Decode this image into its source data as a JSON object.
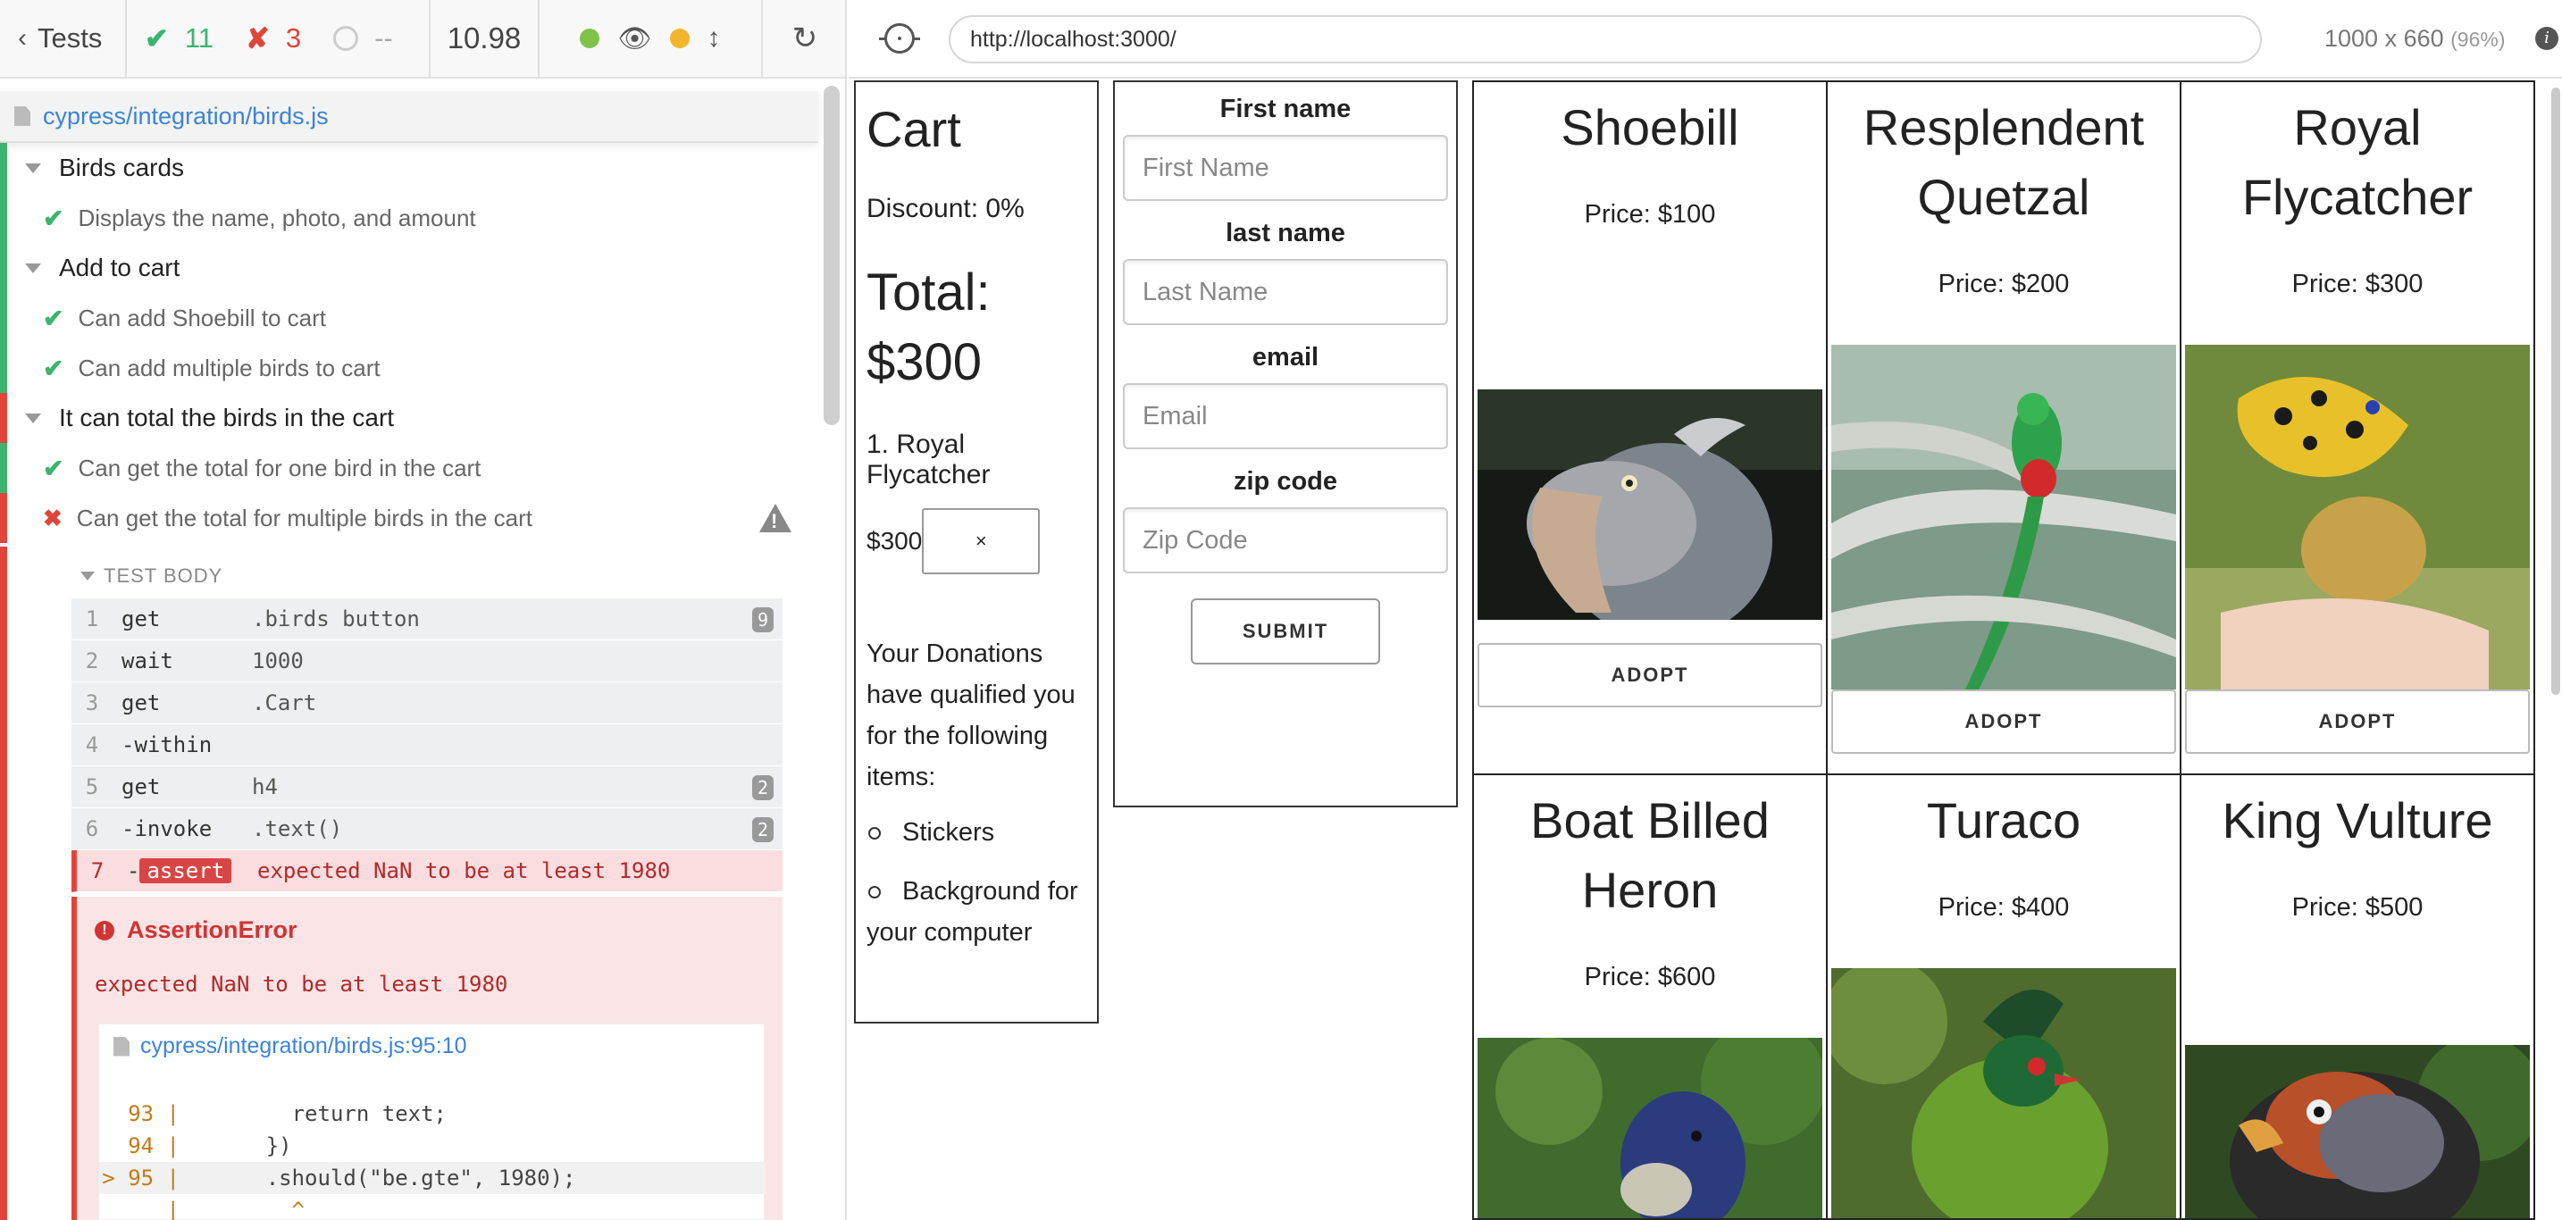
{
  "runner": {
    "back_label": "Tests",
    "passed": "11",
    "failed": "3",
    "pending": "--",
    "duration": "10.98",
    "spec_path": "cypress/integration/birds.js",
    "suites": [
      {
        "title": "Birds cards",
        "tests": [
          {
            "title": "Displays the name, photo, and amount",
            "state": "passed"
          }
        ]
      },
      {
        "title": "Add to cart",
        "tests": [
          {
            "title": "Can add Shoebill to cart",
            "state": "passed"
          },
          {
            "title": "Can add multiple birds to cart",
            "state": "passed"
          }
        ]
      },
      {
        "title": "It can total the birds in the cart",
        "tests": [
          {
            "title": "Can get the total for one bird in the cart",
            "state": "passed"
          },
          {
            "title": "Can get the total for multiple birds in the cart",
            "state": "failed"
          }
        ]
      }
    ],
    "test_body_label": "TEST BODY",
    "commands": [
      {
        "num": "1",
        "name": "get",
        "msg": ".birds button",
        "badge": "9"
      },
      {
        "num": "2",
        "name": "wait",
        "msg": "1000",
        "badge": ""
      },
      {
        "num": "3",
        "name": "get",
        "msg": ".Cart",
        "badge": ""
      },
      {
        "num": "4",
        "name": "-within",
        "msg": "",
        "badge": ""
      },
      {
        "num": "5",
        "name": "get",
        "msg": "h4",
        "badge": "2"
      },
      {
        "num": "6",
        "name": "-invoke",
        "msg": ".text()",
        "badge": "2"
      },
      {
        "num": "7",
        "name": "assert",
        "msg": "expected NaN to be at least 1980",
        "badge": ""
      }
    ],
    "error": {
      "title": "AssertionError",
      "message": "expected NaN to be at least 1980",
      "file": "cypress/integration/birds.js:95:10",
      "lines": [
        {
          "ln": "93 |",
          "code": "        return text;"
        },
        {
          "ln": "94 |",
          "code": "      })"
        },
        {
          "ln": "> 95 |",
          "code": "      .should(\"be.gte\", 1980);"
        },
        {
          "ln": "|",
          "code": "        ^"
        }
      ]
    }
  },
  "aut": {
    "url": "http://localhost:3000/",
    "viewport": "1000 x 660",
    "scale": "(96%)",
    "cart": {
      "title": "Cart",
      "discount": "Discount: 0%",
      "total_label": "Total:",
      "total_value": "$300",
      "item": "1. Royal Flycatcher",
      "item_price": "$300",
      "remove_label": "×",
      "note": "Your Donations have qualified you for the following items:",
      "perks": [
        "Stickers",
        "Background for your computer"
      ]
    },
    "form": {
      "fields": [
        {
          "label": "First name",
          "placeholder": "First Name"
        },
        {
          "label": "last name",
          "placeholder": "Last Name"
        },
        {
          "label": "email",
          "placeholder": "Email"
        },
        {
          "label": "zip code",
          "placeholder": "Zip Code"
        }
      ],
      "submit_label": "SUBMIT"
    },
    "birds": [
      {
        "name": "Shoebill",
        "price": "Price: $100",
        "adopt": "ADOPT"
      },
      {
        "name": "Resplendent Quetzal",
        "price": "Price: $200",
        "adopt": "ADOPT"
      },
      {
        "name": "Royal Flycatcher",
        "price": "Price: $300",
        "adopt": "ADOPT"
      },
      {
        "name": "Boat Billed Heron",
        "price": "Price: $600",
        "adopt": ""
      },
      {
        "name": "Turaco",
        "price": "Price: $400",
        "adopt": ""
      },
      {
        "name": "King Vulture",
        "price": "Price: $500",
        "adopt": ""
      }
    ]
  },
  "colors": {
    "pass": "#3cb371",
    "fail": "#e0453a",
    "link": "#3b83d9"
  }
}
